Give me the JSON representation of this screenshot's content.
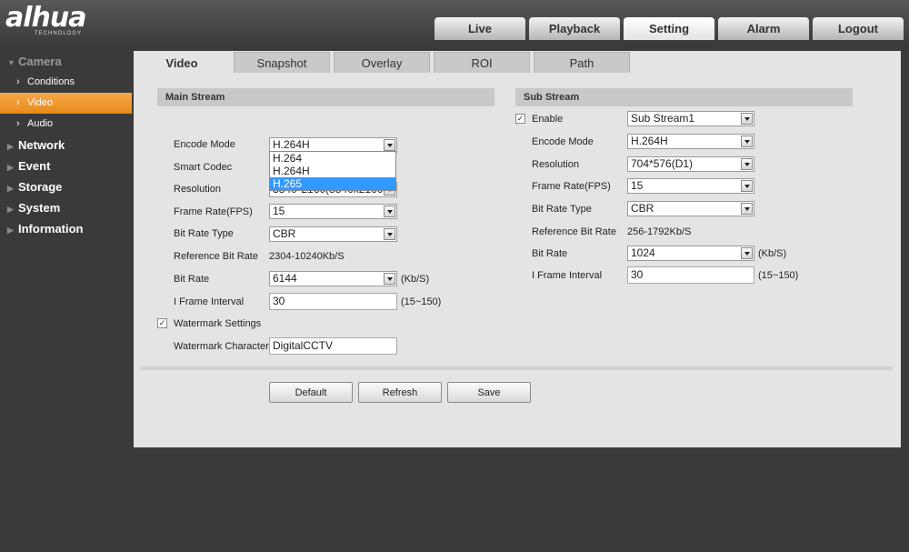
{
  "brand": {
    "name": "alhua",
    "sub": "TECHNOLOGY"
  },
  "top_tabs": [
    "Live",
    "Playback",
    "Setting",
    "Alarm",
    "Logout"
  ],
  "sidebar": {
    "camera": "Camera",
    "camera_items": [
      "Conditions",
      "Video",
      "Audio"
    ],
    "sections": [
      "Network",
      "Event",
      "Storage",
      "System",
      "Information"
    ]
  },
  "sub_tabs": [
    "Video",
    "Snapshot",
    "Overlay",
    "ROI",
    "Path"
  ],
  "main": {
    "title": "Main Stream",
    "encode_mode_label": "Encode Mode",
    "encode_mode": "H.264H",
    "encode_options": [
      "H.264",
      "H.264H",
      "H.265"
    ],
    "smart_codec_label": "Smart Codec",
    "resolution_label": "Resolution",
    "resolution": "3840*2160(3840x2160)",
    "frame_rate_label": "Frame Rate(FPS)",
    "frame_rate": "15",
    "bit_rate_type_label": "Bit Rate Type",
    "bit_rate_type": "CBR",
    "ref_bit_rate_label": "Reference Bit Rate",
    "ref_bit_rate": "2304-10240Kb/S",
    "bit_rate_label": "Bit Rate",
    "bit_rate": "6144",
    "bit_rate_unit": "(Kb/S)",
    "i_frame_label": "I Frame Interval",
    "i_frame": "30",
    "i_frame_range": "(15~150)",
    "watermark_label": "Watermark Settings",
    "watermark_char_label": "Watermark Character",
    "watermark_char": "DigitalCCTV"
  },
  "sub": {
    "title": "Sub Stream",
    "enable_label": "Enable",
    "stream": "Sub Stream1",
    "encode_mode_label": "Encode Mode",
    "encode_mode": "H.264H",
    "resolution_label": "Resolution",
    "resolution": "704*576(D1)",
    "frame_rate_label": "Frame Rate(FPS)",
    "frame_rate": "15",
    "bit_rate_type_label": "Bit Rate Type",
    "bit_rate_type": "CBR",
    "ref_bit_rate_label": "Reference Bit Rate",
    "ref_bit_rate": "256-1792Kb/S",
    "bit_rate_label": "Bit Rate",
    "bit_rate": "1024",
    "bit_rate_unit": "(Kb/S)",
    "i_frame_label": "I Frame Interval",
    "i_frame": "30",
    "i_frame_range": "(15~150)"
  },
  "buttons": {
    "default": "Default",
    "refresh": "Refresh",
    "save": "Save"
  },
  "check_mark": "✓"
}
